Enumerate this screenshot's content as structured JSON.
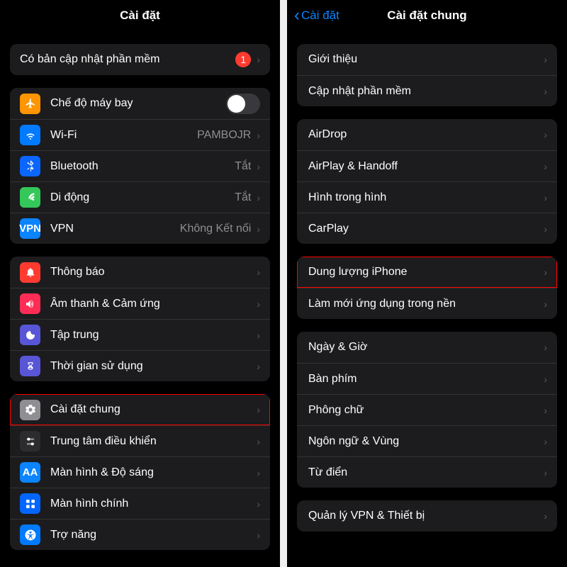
{
  "left": {
    "title": "Cài đặt",
    "update": {
      "label": "Có bản cập nhật phần mềm",
      "badge": "1"
    },
    "network": {
      "airplane": {
        "label": "Chế độ máy bay"
      },
      "wifi": {
        "label": "Wi-Fi",
        "value": "PAMBOJR"
      },
      "bluetooth": {
        "label": "Bluetooth",
        "value": "Tắt"
      },
      "cellular": {
        "label": "Di động",
        "value": "Tắt"
      },
      "vpn": {
        "label": "VPN",
        "value": "Không Kết nối",
        "icon_text": "VPN"
      }
    },
    "system1": {
      "notifications": {
        "label": "Thông báo"
      },
      "sound": {
        "label": "Âm thanh & Cảm ứng"
      },
      "focus": {
        "label": "Tập trung"
      },
      "screentime": {
        "label": "Thời gian sử dụng"
      }
    },
    "system2": {
      "general": {
        "label": "Cài đặt chung"
      },
      "controlcenter": {
        "label": "Trung tâm điều khiển"
      },
      "display": {
        "label": "Màn hình & Độ sáng",
        "icon_text": "AA"
      },
      "home": {
        "label": "Màn hình chính"
      },
      "accessibility": {
        "label": "Trợ năng"
      }
    }
  },
  "right": {
    "back": "Cài đặt",
    "title": "Cài đặt chung",
    "g1": {
      "about": "Giới thiệu",
      "update": "Cập nhật phần mềm"
    },
    "g2": {
      "airdrop": "AirDrop",
      "airplay": "AirPlay & Handoff",
      "pip": "Hình trong hình",
      "carplay": "CarPlay"
    },
    "g3": {
      "storage": "Dung lượng iPhone",
      "background": "Làm mới ứng dụng trong nền"
    },
    "g4": {
      "datetime": "Ngày & Giờ",
      "keyboard": "Bàn phím",
      "fonts": "Phông chữ",
      "language": "Ngôn ngữ & Vùng",
      "dictionary": "Từ điển"
    },
    "g5": {
      "vpn": "Quản lý VPN & Thiết bị"
    }
  }
}
